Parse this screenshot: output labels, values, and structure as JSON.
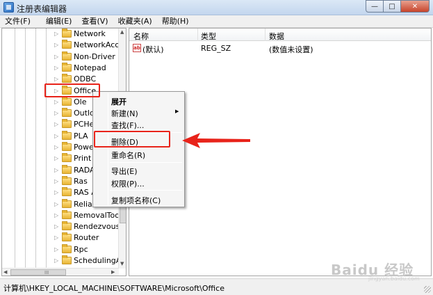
{
  "window": {
    "title": "注册表编辑器",
    "buttons": {
      "minimize": "—",
      "maximize": "□",
      "close": "✕"
    }
  },
  "menu": [
    "文件(F)",
    "编辑(E)",
    "查看(V)",
    "收藏夹(A)",
    "帮助(H)"
  ],
  "tree": {
    "items": [
      "Network",
      "NetworkAcce",
      "Non-Driver S",
      "Notepad",
      "ODBC",
      "Office",
      "Ole",
      "Outlo",
      "PCHea",
      "PLA",
      "Powe",
      "Print",
      "RADA",
      "Ras",
      "RAS A",
      "Reliab",
      "RemovalTool",
      "RendezvousA",
      "Router",
      "Rpc",
      "SchedulingAg"
    ],
    "selected": "Office",
    "expander_glyph": "▷",
    "scroll_grip": "III"
  },
  "list": {
    "columns": [
      "名称",
      "类型",
      "数据"
    ],
    "rows": [
      {
        "icon": "ab",
        "name": "(默认)",
        "type": "REG_SZ",
        "data": "(数值未设置)"
      }
    ]
  },
  "context_menu": {
    "items": [
      "展开",
      "新建(N)",
      "查找(F)...",
      "删除(D)",
      "重命名(R)",
      "导出(E)",
      "权限(P)...",
      "复制项名称(C)"
    ],
    "highlighted": "删除(D)",
    "submenu_glyph": "▶"
  },
  "status_bar": {
    "path": "计算机\\HKEY_LOCAL_MACHINE\\SOFTWARE\\Microsoft\\Office"
  },
  "watermark": {
    "main": "Baidu 经验",
    "sub": "jingyan.baidu.com"
  },
  "colors": {
    "highlight": "#e8231a",
    "titlebar": "#c3d6ee",
    "folder": "#e8b533"
  }
}
